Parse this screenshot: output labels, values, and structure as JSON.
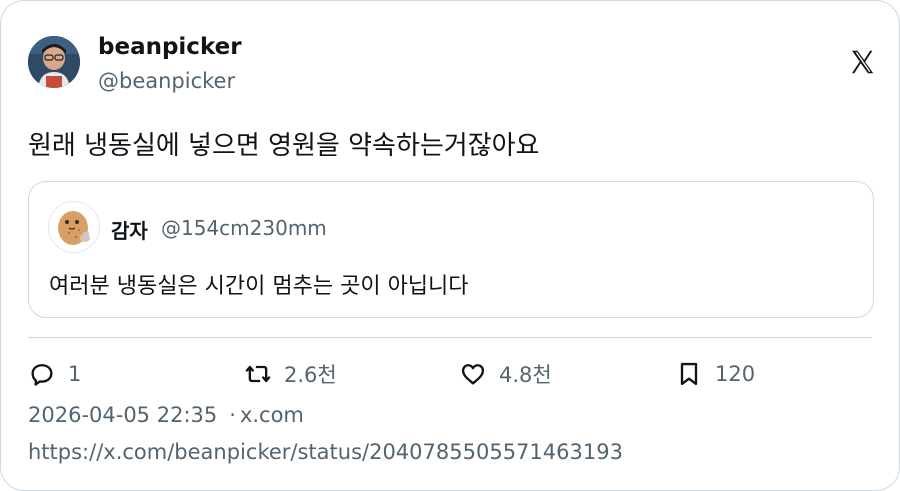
{
  "author": {
    "name": "beanpicker",
    "handle": "@beanpicker",
    "avatar_icon": "profile-photo"
  },
  "platform_icon": "x-logo-icon",
  "tweet": {
    "text": "원래 냉동실에 넣으면 영원을 약속하는거잖아요"
  },
  "quoted_tweet": {
    "name": "감자",
    "handle": "@154cm230mm",
    "avatar_icon": "potato-character-icon",
    "text": "여러분 냉동실은 시간이 멈추는 곳이 아닙니다"
  },
  "actions": {
    "replies": "1",
    "reposts": "2.6천",
    "likes": "4.8천",
    "bookmarks": "120"
  },
  "meta": {
    "timestamp": "2026-04-05 22:35",
    "separator": "·",
    "source": "x.com",
    "status_url": "https://x.com/beanpicker/status/2040785505571463193"
  },
  "colors": {
    "text_primary": "#0f1419",
    "text_secondary": "#536471",
    "border": "#cfd9de"
  }
}
